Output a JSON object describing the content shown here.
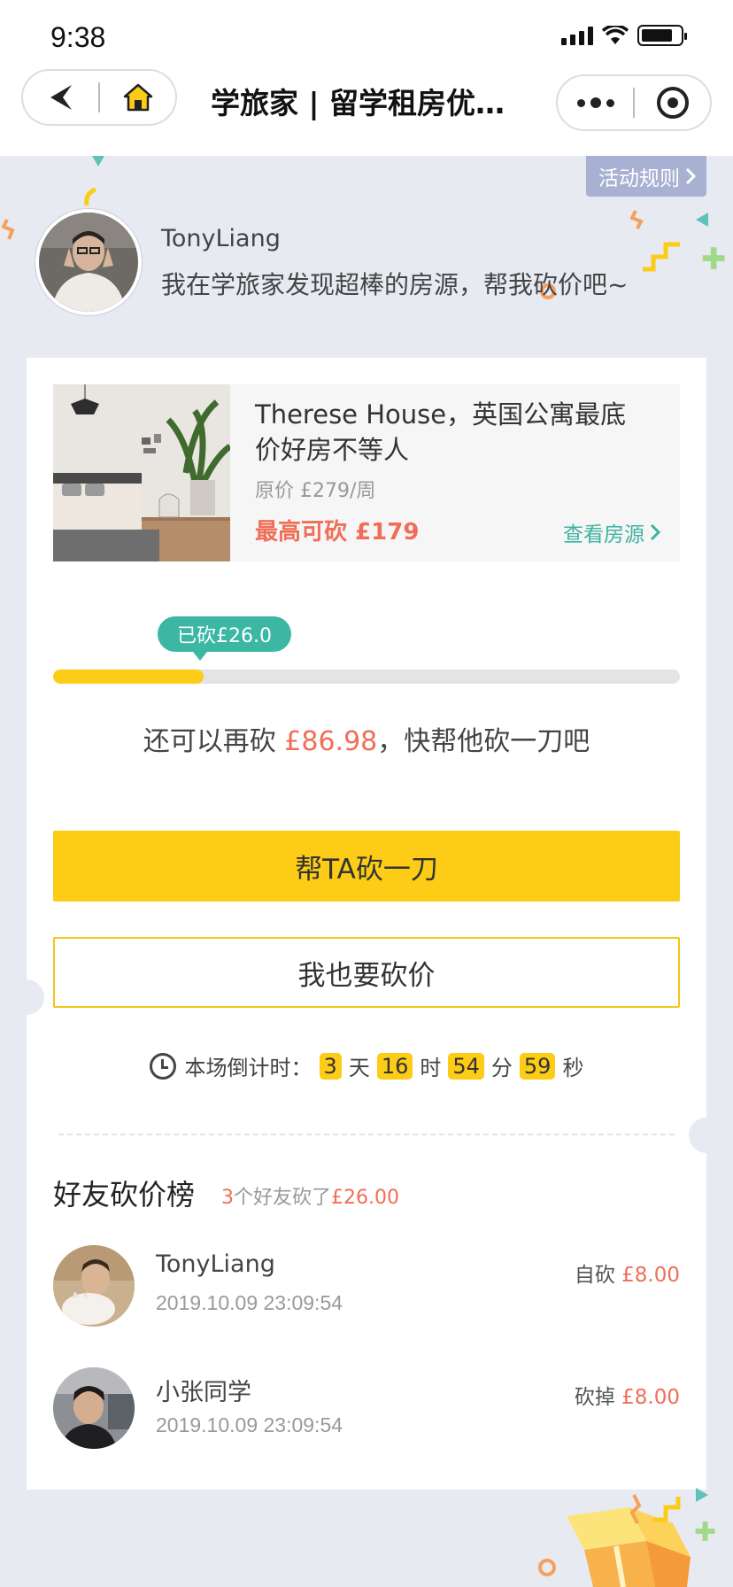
{
  "status": {
    "time": "9:38"
  },
  "nav": {
    "title": "学旅家 | 留学租房优惠..."
  },
  "rules": {
    "label": "活动规则"
  },
  "host": {
    "name": "TonyLiang",
    "message": "我在学旅家发现超棒的房源，帮我砍价吧~"
  },
  "house": {
    "title": "Therese House，英国公寓最底价好房不等人",
    "original_price": "原价 £279/周",
    "max_cut": "最高可砍 £179",
    "view_link": "查看房源"
  },
  "progress": {
    "bubble": "已砍£26.0",
    "fraction": 0.24
  },
  "remain": {
    "prefix": "还可以再砍 ",
    "amount": "£86.98",
    "suffix": "，快帮他砍一刀吧"
  },
  "buttons": {
    "help": "帮TA砍一刀",
    "me_too": "我也要砍价"
  },
  "countdown": {
    "label": "本场倒计时：",
    "days": "3",
    "days_unit": "天",
    "hours": "16",
    "hours_unit": "时",
    "minutes": "54",
    "minutes_unit": "分",
    "seconds": "59",
    "seconds_unit": "秒"
  },
  "ranking": {
    "title": "好友砍价榜",
    "count": "3",
    "count_text": "个好友砍了",
    "total": "£26.00",
    "items": [
      {
        "name": "TonyLiang",
        "time": "2019.10.09 23:09:54",
        "action": "自砍",
        "amount": "£8.00"
      },
      {
        "name": "小张同学",
        "time": "2019.10.09 23:09:54",
        "action": "砍掉",
        "amount": "£8.00"
      }
    ]
  },
  "colors": {
    "accent_yellow": "#fccc16",
    "teal": "#3bb7a4",
    "price_red": "#f06e58",
    "background": "#e8eaf2"
  },
  "icons": [
    "back-arrow-icon",
    "home-icon",
    "more-dots-icon",
    "target-icon",
    "chevron-right-icon",
    "clock-icon"
  ]
}
